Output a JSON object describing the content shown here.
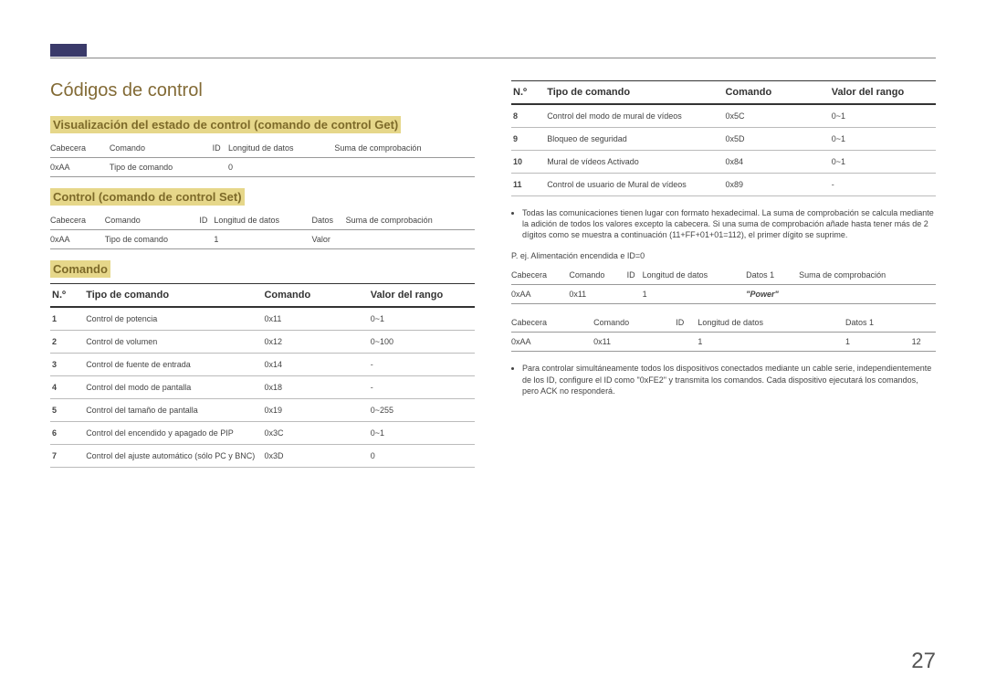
{
  "title": "Códigos de control",
  "section_get": {
    "heading": "Visualización del estado de control (comando de control Get)",
    "headers": [
      "Cabecera",
      "Comando",
      "ID",
      "Longitud de datos",
      "Suma de comprobación"
    ],
    "row": [
      "0xAA",
      "Tipo de comando",
      "",
      "0",
      ""
    ]
  },
  "section_set": {
    "heading": "Control (comando de control Set)",
    "headers": [
      "Cabecera",
      "Comando",
      "ID",
      "Longitud de datos",
      "Datos",
      "Suma de comprobación"
    ],
    "row": [
      "0xAA",
      "Tipo de comando",
      "",
      "1",
      "Valor",
      ""
    ]
  },
  "section_cmd": {
    "heading": "Comando",
    "th": [
      "N.º",
      "Tipo de comando",
      "Comando",
      "Valor del rango"
    ],
    "rows_left": [
      {
        "n": "1",
        "t": "Control de potencia",
        "c": "0x11",
        "r": "0~1"
      },
      {
        "n": "2",
        "t": "Control de volumen",
        "c": "0x12",
        "r": "0~100"
      },
      {
        "n": "3",
        "t": "Control de fuente de entrada",
        "c": "0x14",
        "r": "-"
      },
      {
        "n": "4",
        "t": "Control del modo de pantalla",
        "c": "0x18",
        "r": "-"
      },
      {
        "n": "5",
        "t": "Control del tamaño de pantalla",
        "c": "0x19",
        "r": "0~255"
      },
      {
        "n": "6",
        "t": "Control del encendido y apagado de PIP",
        "c": "0x3C",
        "r": "0~1"
      },
      {
        "n": "7",
        "t": "Control del ajuste automático (sólo PC y BNC)",
        "c": "0x3D",
        "r": "0"
      }
    ],
    "rows_right": [
      {
        "n": "8",
        "t": "Control del modo de mural de vídeos",
        "c": "0x5C",
        "r": "0~1"
      },
      {
        "n": "9",
        "t": "Bloqueo de seguridad",
        "c": "0x5D",
        "r": "0~1"
      },
      {
        "n": "10",
        "t": "Mural de vídeos Activado",
        "c": "0x84",
        "r": "0~1"
      },
      {
        "n": "11",
        "t": "Control de usuario de Mural de vídeos",
        "c": "0x89",
        "r": "-"
      }
    ]
  },
  "bullet1": "Todas las comunicaciones tienen lugar con formato hexadecimal. La suma de comprobación se calcula mediante la adición de todos los valores excepto la cabecera. Si una suma de comprobación añade hasta tener más de 2 dígitos como se muestra a continuación (11+FF+01+01=112), el primer dígito se suprime.",
  "example_label": "P. ej. Alimentación encendida e ID=0",
  "example1": {
    "headers": [
      "Cabecera",
      "Comando",
      "ID",
      "Longitud de datos",
      "Datos 1",
      "Suma de comprobación"
    ],
    "row": [
      "0xAA",
      "0x11",
      "",
      "1",
      "\"Power\"",
      ""
    ]
  },
  "example2": {
    "headers": [
      "Cabecera",
      "Comando",
      "ID",
      "Longitud de datos",
      "Datos 1",
      ""
    ],
    "row": [
      "0xAA",
      "0x11",
      "",
      "1",
      "1",
      "12"
    ]
  },
  "bullet2": "Para controlar simultáneamente todos los dispositivos conectados mediante un cable serie, independientemente de los ID, configure el ID como \"0xFE2\" y transmita los comandos. Cada dispositivo ejecutará los comandos, pero ACK no responderá.",
  "pagenum": "27"
}
